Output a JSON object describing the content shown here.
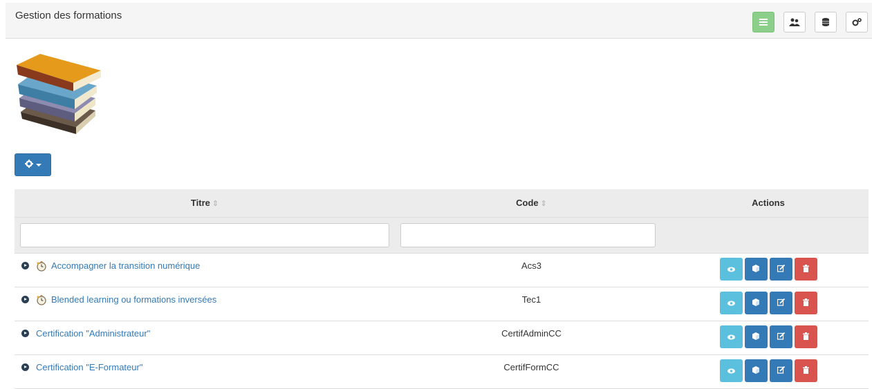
{
  "header": {
    "title": "Gestion des formations",
    "buttons": [
      {
        "icon": "list-icon",
        "active": true
      },
      {
        "icon": "users-icon",
        "active": false
      },
      {
        "icon": "database-icon",
        "active": false
      },
      {
        "icon": "cogs-icon",
        "active": false
      }
    ]
  },
  "logo": {
    "icon": "books-stack-icon"
  },
  "toolbar": {
    "gear_icon": "gear-icon"
  },
  "table": {
    "columns": [
      "Titre",
      "Code",
      "Actions"
    ],
    "sort_glyph": "⇕",
    "filters": {
      "titre": "",
      "code": ""
    },
    "rows": [
      {
        "titre": "Accompagner la transition numérique",
        "code": "Acs3",
        "clock": true
      },
      {
        "titre": "Blended learning ou formations inversées",
        "code": "Tec1",
        "clock": true
      },
      {
        "titre": "Certification \"Administrateur\"",
        "code": "CertifAdminCC",
        "clock": false
      },
      {
        "titre": "Certification \"E-Formateur\"",
        "code": "CertifFormCC",
        "clock": false
      }
    ]
  },
  "colors": {
    "primary": "#337ab7",
    "info": "#5bc0de",
    "danger": "#d9534f",
    "success": "#8ccf8a",
    "header_bg": "#f5f5f5",
    "table_head_bg": "#ececec"
  }
}
